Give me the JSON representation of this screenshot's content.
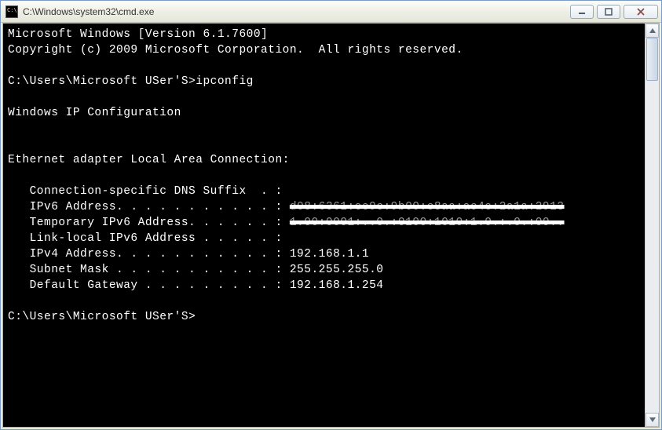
{
  "window": {
    "title": "C:\\Windows\\system32\\cmd.exe"
  },
  "terminal": {
    "header1": "Microsoft Windows [Version 6.1.7600]",
    "header2": "Copyright (c) 2009 Microsoft Corporation.  All rights reserved.",
    "prompt_path": "C:\\Users\\Microsoft USer'S>",
    "command": "ipconfig",
    "section_title": "Windows IP Configuration",
    "adapter_title": "Ethernet adapter Local Area Connection:",
    "rows": {
      "dns_suffix": "   Connection-specific DNS Suffix  . :",
      "ipv6_label": "   IPv6 Address. . . . . . . . . . . : ",
      "ipv6_masked": "d08:6361:ee9c:9b00:c8aa:ac4e:2a1a:2913",
      "temp_ipv6_label": "   Temporary IPv6 Address. . . . . . : ",
      "temp_ipv6_masked": "1.00:0001:..0.:0100:1010:1.0.:.0.:00..",
      "linklocal": "   Link-local IPv6 Address . . . . . :",
      "ipv4": "   IPv4 Address. . . . . . . . . . . : 192.168.1.1",
      "subnet": "   Subnet Mask . . . . . . . . . . . : 255.255.255.0",
      "gateway": "   Default Gateway . . . . . . . . . : 192.168.1.254"
    },
    "prompt2": "C:\\Users\\Microsoft USer'S>"
  }
}
